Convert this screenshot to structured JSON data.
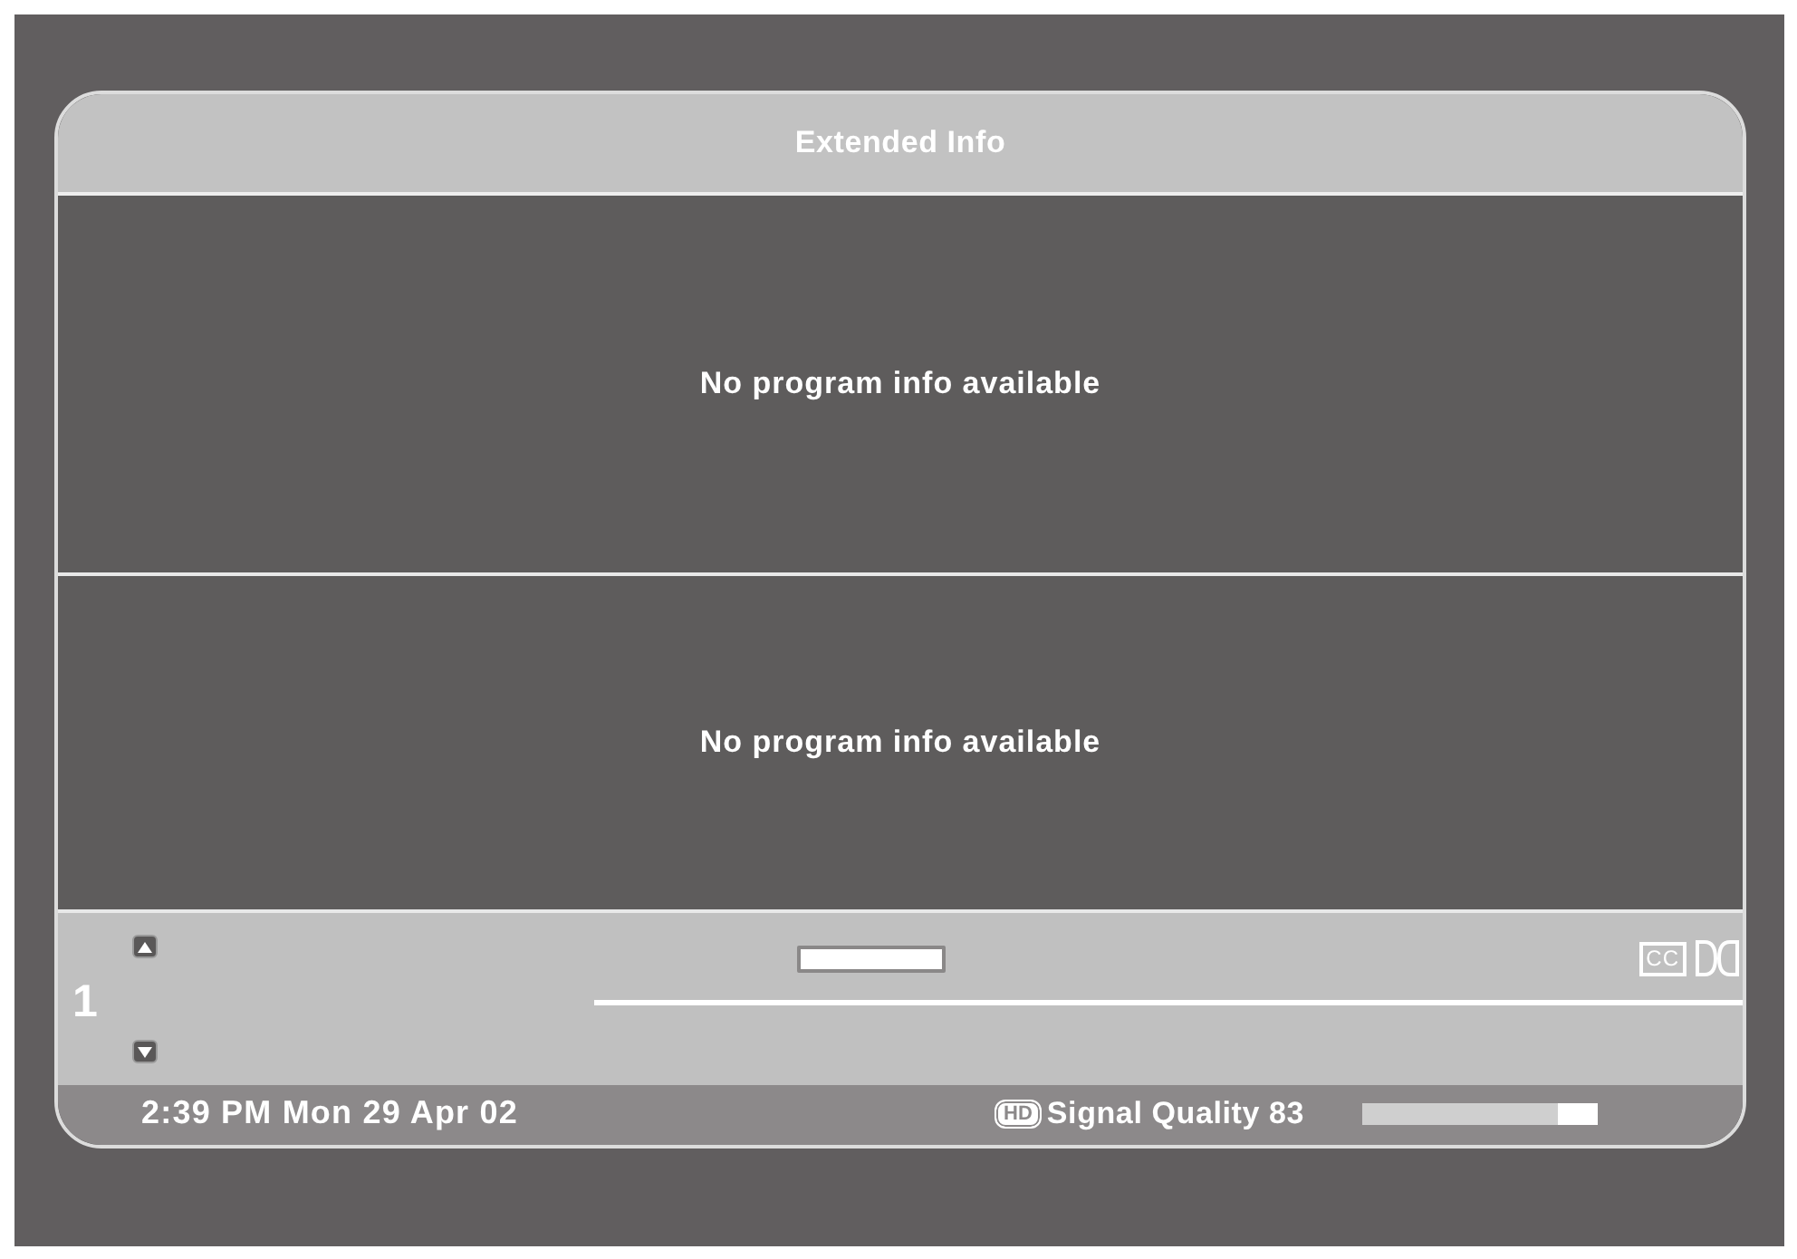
{
  "window": {
    "title": "Extended Info"
  },
  "info_panels": [
    {
      "text": "No program info available"
    },
    {
      "text": "No program info available"
    }
  ],
  "channel": {
    "number": "1"
  },
  "indicators": {
    "cc": "CC"
  },
  "status_bar": {
    "datetime": "2:39 PM Mon 29 Apr 02",
    "hd": "HD",
    "signal_label": "Signal Quality 83",
    "signal": {
      "level": 0.83
    }
  }
}
